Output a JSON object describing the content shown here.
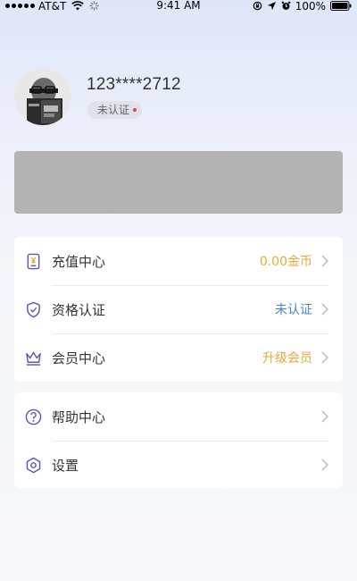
{
  "status_bar": {
    "carrier": "AT&T",
    "time": "9:41 AM",
    "battery": "100%"
  },
  "profile": {
    "username": "123****2712",
    "verify_status": "未认证"
  },
  "menu_group_1": [
    {
      "label": "充值中心",
      "value": "0.00金币",
      "value_color": "#e8a93a",
      "icon": "wallet-icon"
    },
    {
      "label": "资格认证",
      "value": "未认证",
      "value_color": "#4a86d8",
      "icon": "shield-icon"
    },
    {
      "label": "会员中心",
      "value": "升级会员",
      "value_color": "#e8a93a",
      "icon": "crown-icon"
    }
  ],
  "menu_group_2": [
    {
      "label": "帮助中心",
      "icon": "help-icon"
    },
    {
      "label": "设置",
      "icon": "settings-icon"
    }
  ],
  "colors": {
    "icon_accent": "#5a58b5",
    "gold": "#e8a93a",
    "blue": "#4a86d8"
  }
}
